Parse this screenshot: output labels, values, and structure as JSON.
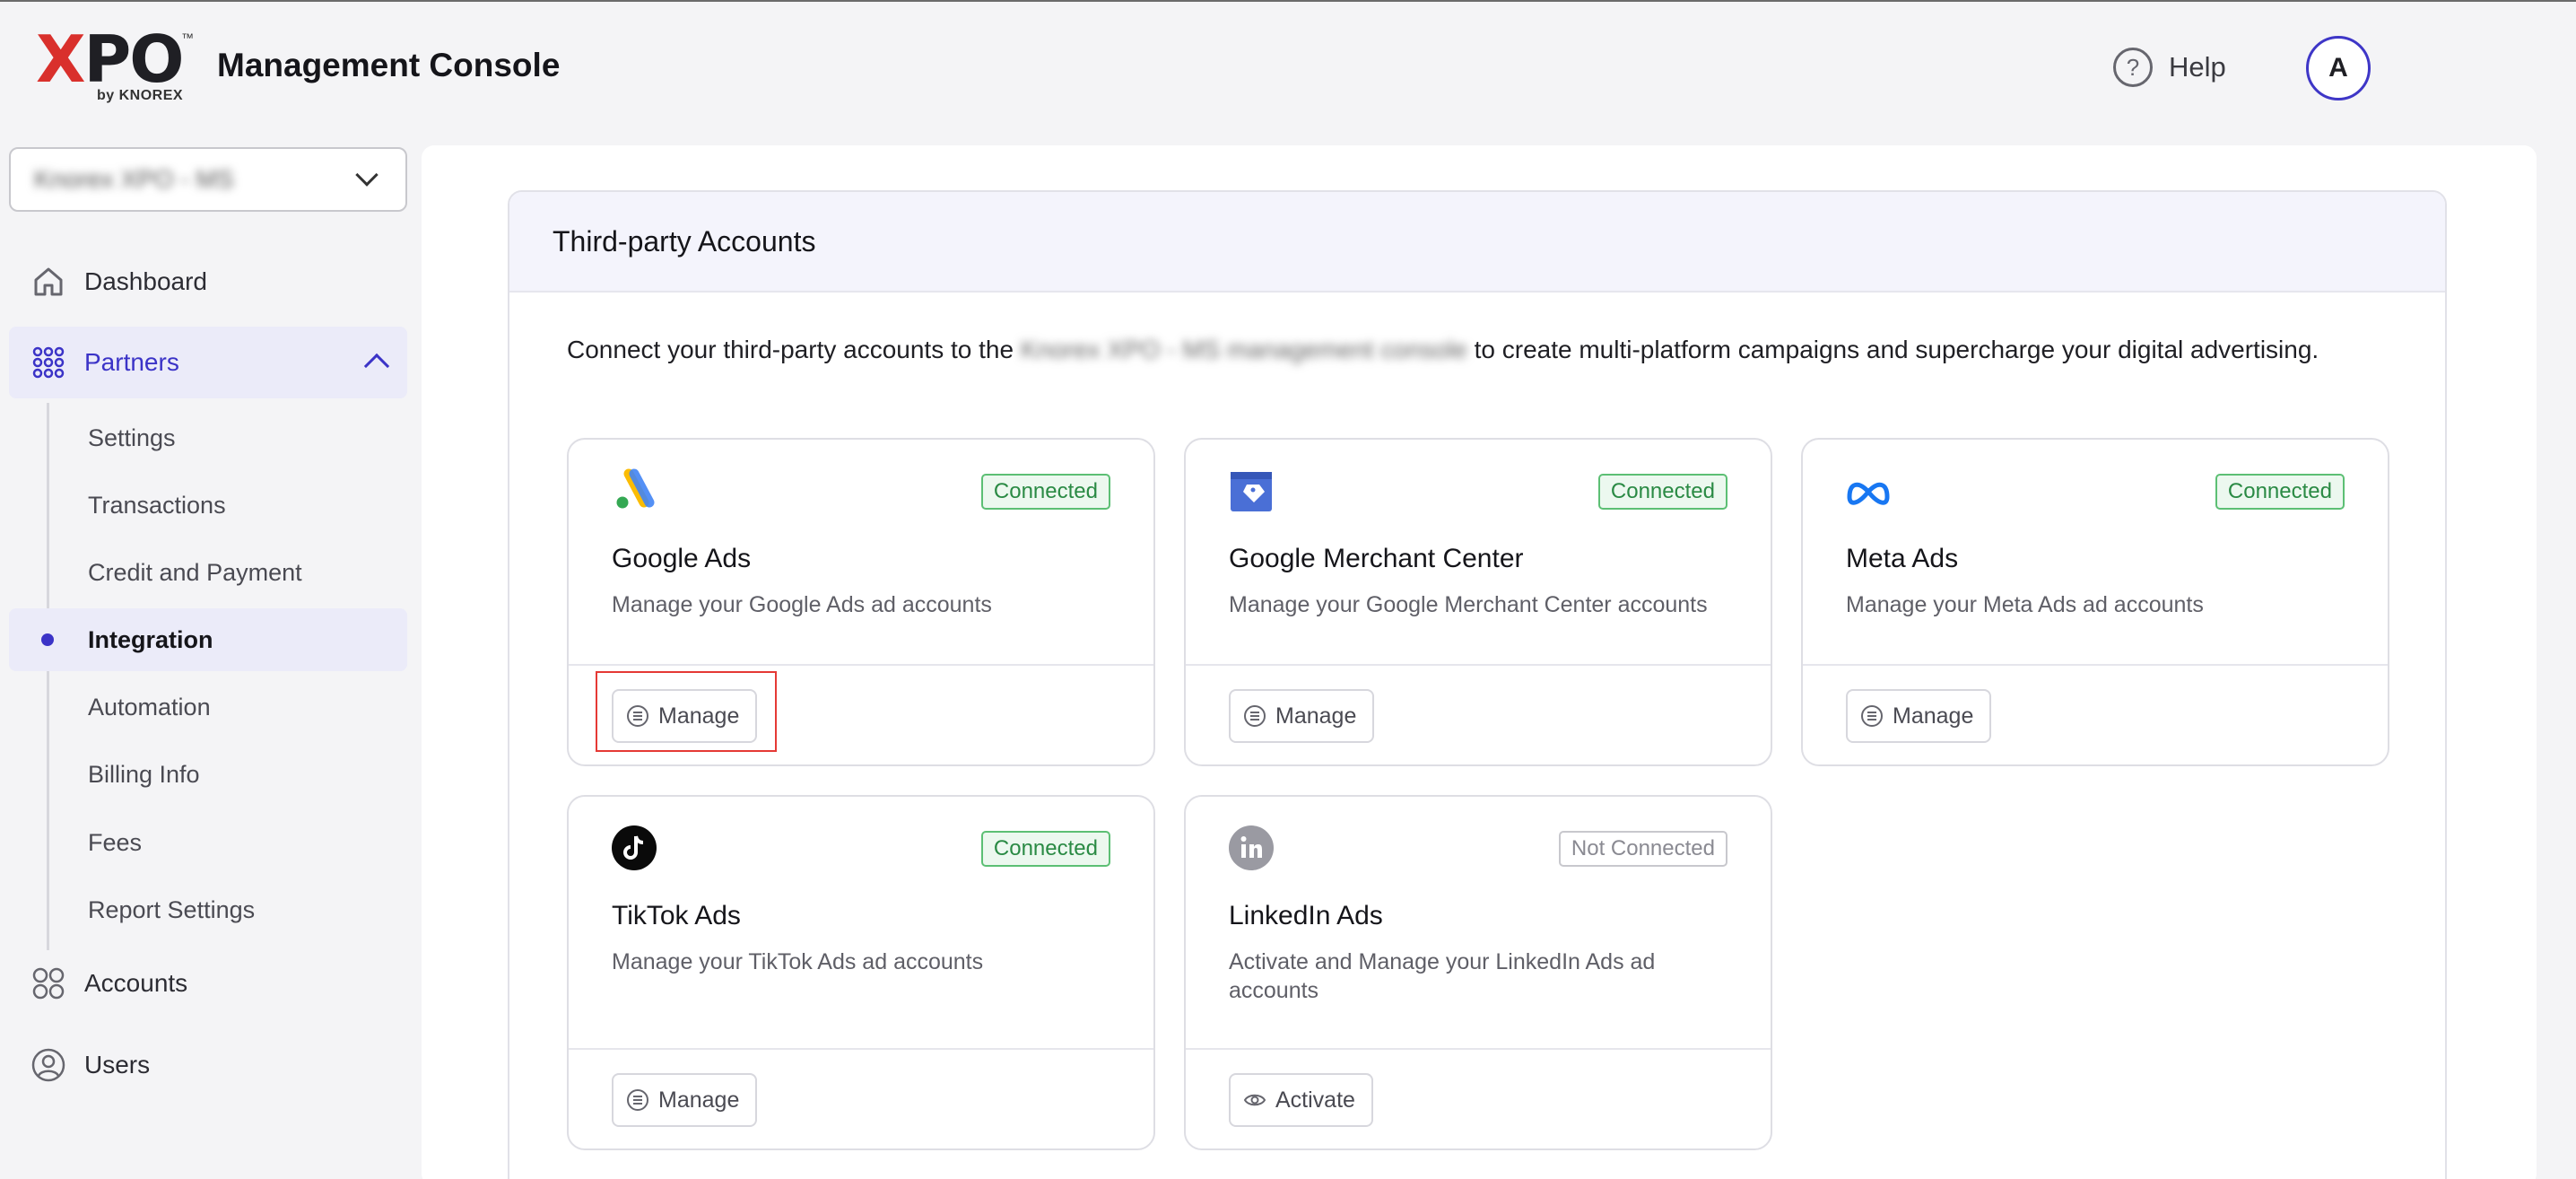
{
  "header": {
    "logo": {
      "x": "X",
      "po": "PO",
      "tm": "™",
      "by": "by KNOREX"
    },
    "title": "Management Console",
    "help_label": "Help",
    "help_glyph": "?",
    "avatar_initial": "A"
  },
  "sidebar": {
    "workspace_value": "Knorex XPO - MS",
    "items": [
      {
        "label": "Dashboard",
        "icon": "home-icon"
      },
      {
        "label": "Partners",
        "icon": "grid-dots-icon",
        "active": true
      },
      {
        "label": "Accounts",
        "icon": "four-circles-icon"
      },
      {
        "label": "Users",
        "icon": "user-circle-icon"
      }
    ],
    "partners_sub": [
      {
        "label": "Settings"
      },
      {
        "label": "Transactions"
      },
      {
        "label": "Credit and Payment"
      },
      {
        "label": "Integration",
        "active": true
      },
      {
        "label": "Automation"
      },
      {
        "label": "Billing Info"
      },
      {
        "label": "Fees"
      },
      {
        "label": "Report Settings"
      }
    ]
  },
  "main": {
    "panel_title": "Third-party Accounts",
    "intro_before": "Connect your third-party accounts to the ",
    "intro_blurred": "Knorex XPO - MS management console",
    "intro_after": " to create multi-platform campaigns and supercharge your digital advertising.",
    "cards": [
      {
        "name": "Google Ads",
        "status": "Connected",
        "desc": "Manage your Google Ads ad accounts",
        "button": "Manage",
        "icon": "google-ads-icon"
      },
      {
        "name": "Google Merchant Center",
        "status": "Connected",
        "desc": "Manage your Google Merchant Center accounts",
        "button": "Manage",
        "icon": "google-merchant-icon"
      },
      {
        "name": "Meta Ads",
        "status": "Connected",
        "desc": "Manage your Meta Ads ad accounts",
        "button": "Manage",
        "icon": "meta-icon"
      },
      {
        "name": "TikTok Ads",
        "status": "Connected",
        "desc": "Manage your TikTok Ads ad accounts",
        "button": "Manage",
        "icon": "tiktok-icon"
      },
      {
        "name": "LinkedIn Ads",
        "status": "Not Connected",
        "desc": "Activate and Manage your LinkedIn Ads ad accounts",
        "button": "Activate",
        "icon": "linkedin-icon"
      }
    ]
  },
  "colors": {
    "accent": "#3b33c7",
    "connected": "#2a8a44",
    "highlight": "#e53935"
  }
}
